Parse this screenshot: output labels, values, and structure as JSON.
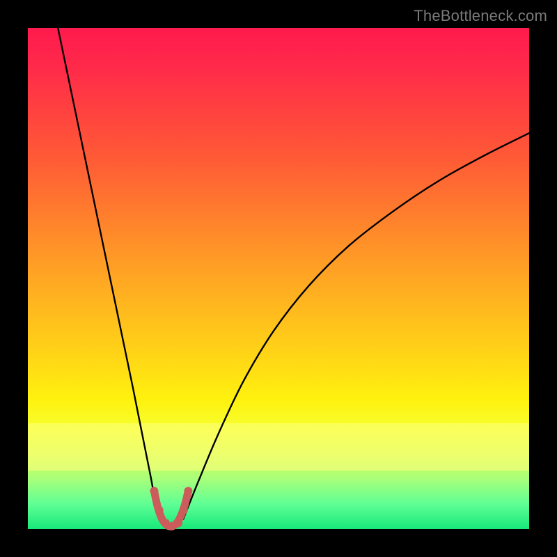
{
  "watermark": "TheBottleneck.com",
  "chart_data": {
    "type": "line",
    "title": "",
    "xlabel": "",
    "ylabel": "",
    "xlim": [
      0,
      1
    ],
    "ylim": [
      0,
      1
    ],
    "grid": false,
    "legend": false,
    "yellow_band": {
      "y0": 0.06,
      "y1": 0.21
    },
    "series": [
      {
        "name": "left-curve",
        "color": "#000000",
        "width": 2.4,
        "x": [
          0.06,
          0.085,
          0.11,
          0.135,
          0.16,
          0.185,
          0.21,
          0.23,
          0.245,
          0.255,
          0.262
        ],
        "y": [
          1.0,
          0.88,
          0.76,
          0.64,
          0.52,
          0.4,
          0.28,
          0.18,
          0.105,
          0.05,
          0.02
        ]
      },
      {
        "name": "right-curve",
        "color": "#000000",
        "width": 2.4,
        "x": [
          0.31,
          0.34,
          0.38,
          0.43,
          0.49,
          0.56,
          0.64,
          0.73,
          0.82,
          0.91,
          1.0
        ],
        "y": [
          0.02,
          0.095,
          0.19,
          0.295,
          0.395,
          0.485,
          0.565,
          0.635,
          0.695,
          0.745,
          0.79
        ]
      },
      {
        "name": "dip-marker",
        "color": "#cc5b5b",
        "width": 11,
        "x": [
          0.252,
          0.258,
          0.265,
          0.273,
          0.281,
          0.289,
          0.297,
          0.305,
          0.313,
          0.32
        ],
        "y": [
          0.076,
          0.048,
          0.026,
          0.012,
          0.006,
          0.006,
          0.012,
          0.026,
          0.048,
          0.076
        ]
      }
    ],
    "marker_dots": {
      "color": "#cc5b5b",
      "r": 6,
      "points": [
        {
          "x": 0.252,
          "y": 0.076
        },
        {
          "x": 0.262,
          "y": 0.038
        },
        {
          "x": 0.275,
          "y": 0.012
        },
        {
          "x": 0.288,
          "y": 0.006
        },
        {
          "x": 0.3,
          "y": 0.012
        },
        {
          "x": 0.311,
          "y": 0.038
        },
        {
          "x": 0.32,
          "y": 0.076
        }
      ]
    }
  }
}
